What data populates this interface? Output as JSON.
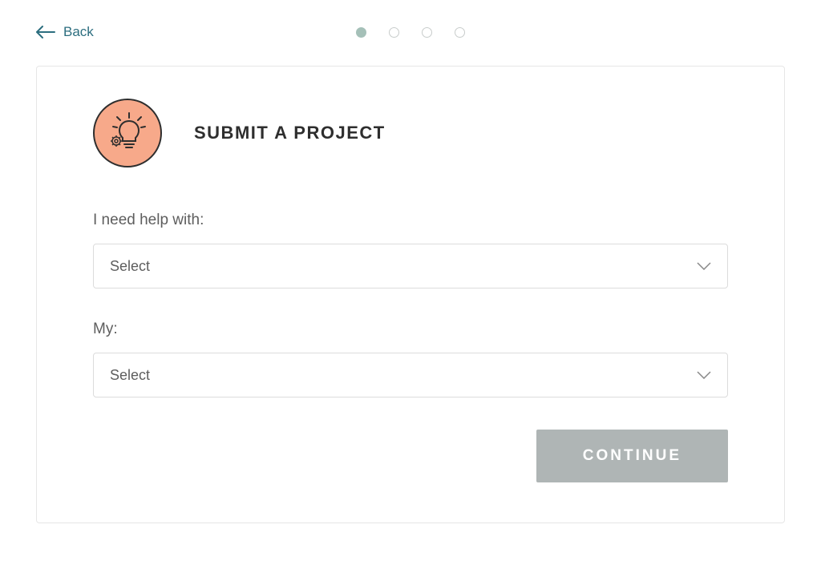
{
  "nav": {
    "back_label": "Back"
  },
  "progress": {
    "current_step": 1,
    "total_steps": 4
  },
  "page": {
    "title": "SUBMIT A PROJECT"
  },
  "form": {
    "field1": {
      "label": "I need help with:",
      "selected": "Select"
    },
    "field2": {
      "label": "My:",
      "selected": "Select"
    }
  },
  "buttons": {
    "continue": "CONTINUE"
  },
  "colors": {
    "accent_teal": "#2c6e7f",
    "icon_bg": "#f7a98a",
    "progress_active": "#a5c0b8",
    "btn_disabled": "#afb5b5"
  }
}
